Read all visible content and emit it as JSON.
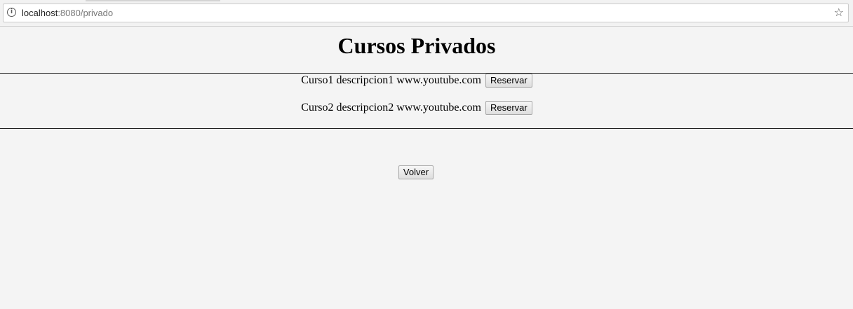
{
  "browser": {
    "url_host": "localhost",
    "url_path": ":8080/privado",
    "info_icon": "info-icon",
    "bookmark_icon": "star-icon"
  },
  "page": {
    "title": "Cursos Privados",
    "courses": [
      {
        "name": "Curso1",
        "description": "descripcion1",
        "link": "www.youtube.com",
        "action_label": "Reservar"
      },
      {
        "name": "Curso2",
        "description": "descripcion2",
        "link": "www.youtube.com",
        "action_label": "Reservar"
      }
    ],
    "back_label": "Volver"
  }
}
